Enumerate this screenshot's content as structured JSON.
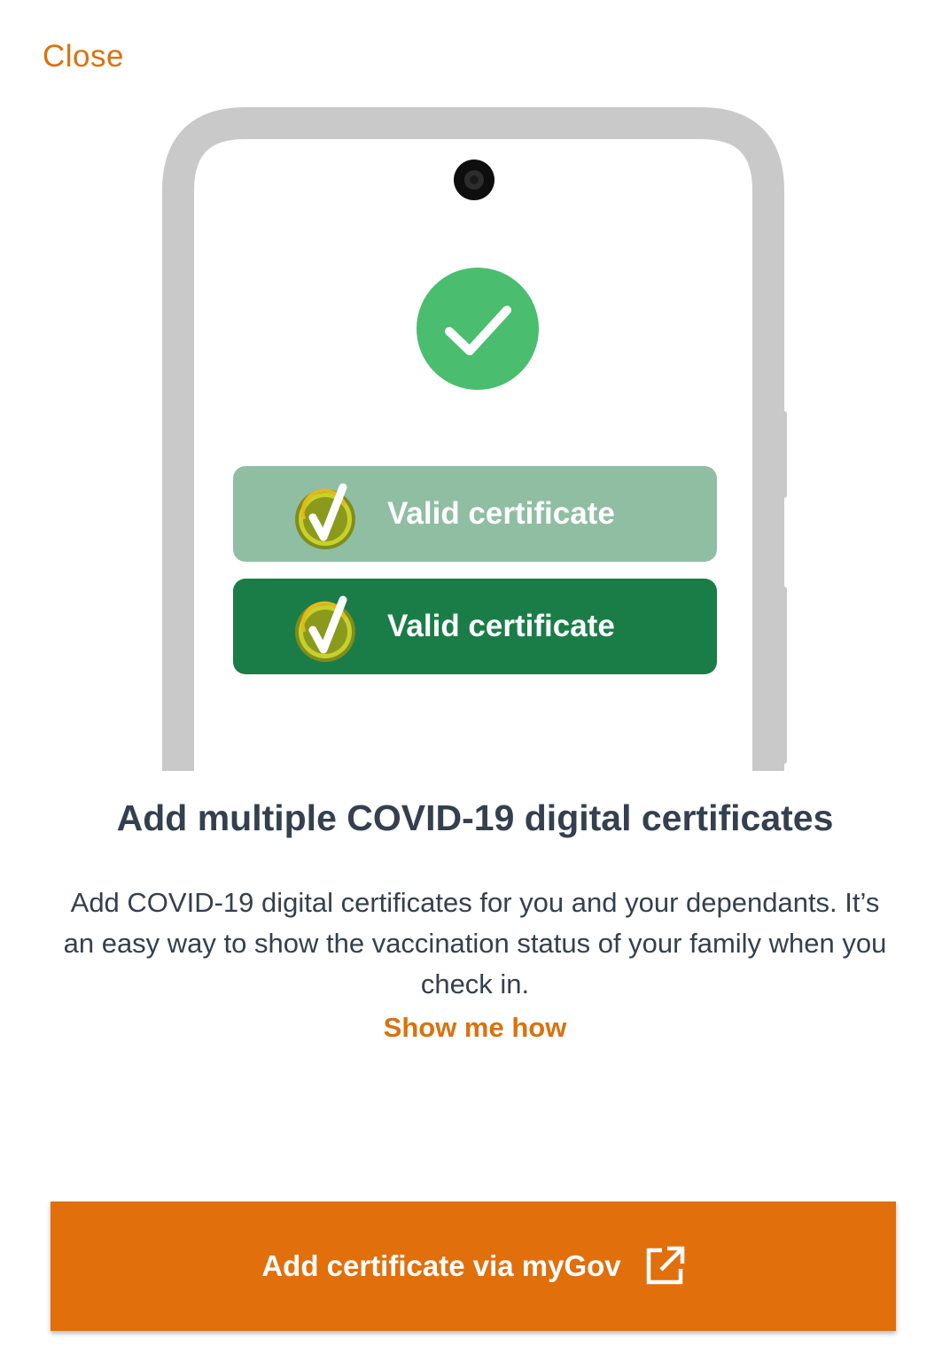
{
  "header": {
    "close_label": "Close"
  },
  "illustration": {
    "certificates": [
      {
        "label": "Valid certificate",
        "color": "#8fbea3"
      },
      {
        "label": "Valid certificate",
        "color": "#1a7d47"
      }
    ],
    "check_color": "#4abd6f",
    "icons": [
      "camera-icon",
      "check-circle-icon",
      "verified-badge-icon"
    ]
  },
  "main": {
    "title": "Add multiple COVID-19 digital certificates",
    "description": "Add COVID-19 digital certificates for you and your dependants. It’s an easy way to show the vaccination status of your family when you check in.",
    "show_me_how_label": "Show me how"
  },
  "footer": {
    "button_label": "Add certificate via myGov",
    "button_icon": "external-link-icon"
  },
  "colors": {
    "accent": "#d9720f",
    "button": "#e06f0c",
    "text": "#34404f"
  }
}
